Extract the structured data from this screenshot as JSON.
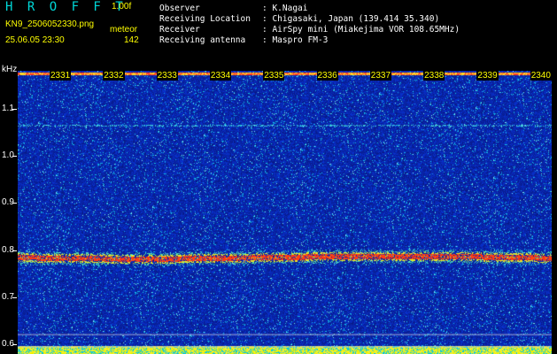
{
  "header": {
    "title": "H R O F F T",
    "version": "1.00f",
    "filename": "KN9_2506052330.png",
    "mode": "meteor",
    "datetime": "25.06.05 23:30",
    "count": "142"
  },
  "station": [
    {
      "label": "Observer",
      "value": ": K.Nagai"
    },
    {
      "label": "Receiving Location",
      "value": ": Chigasaki, Japan (139.414 35.340)"
    },
    {
      "label": "Receiver",
      "value": ": AirSpy mini (Miakejima VOR 108.65MHz)"
    },
    {
      "label": "Receiving antenna",
      "value": ": Maspro FM-3"
    }
  ],
  "axis": {
    "unit": "kHz",
    "y_ticks": [
      "1.1",
      "1.0",
      "0.9",
      "0.8",
      "0.7",
      "0.6"
    ],
    "y_range": [
      0.58,
      1.18
    ],
    "x_ticks": [
      "2331",
      "2332",
      "2333",
      "2334",
      "2335",
      "2336",
      "2337",
      "2338",
      "2339",
      "2340"
    ]
  },
  "colors": {
    "background": "#000000",
    "noise_base": "#0a1e9c",
    "trace": "#ff2020",
    "label_yellow": "#ffff00",
    "title_cyan": "#00d8d8"
  }
}
